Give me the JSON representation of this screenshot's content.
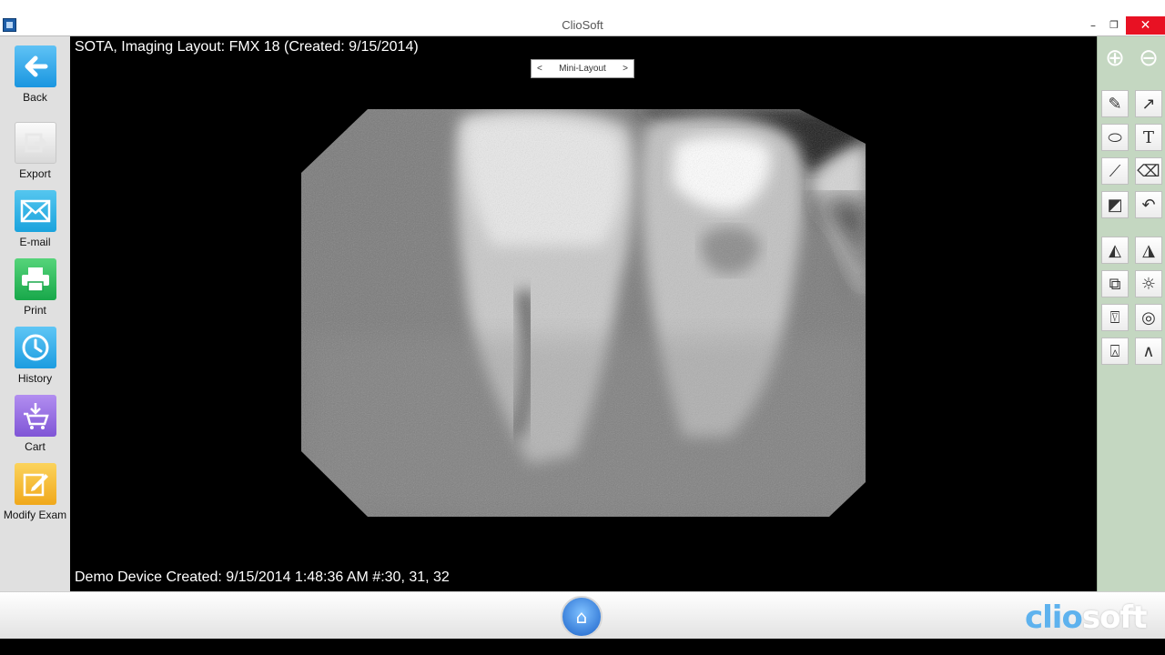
{
  "window": {
    "title": "ClioSoft",
    "min": "–",
    "max": "❐",
    "close": "✕"
  },
  "sidebar": {
    "items": [
      {
        "label": "Back",
        "glyph": "←"
      },
      {
        "label": "Export",
        "glyph": "⇱"
      },
      {
        "label": "E-mail",
        "glyph": "✉"
      },
      {
        "label": "Print",
        "glyph": "⎙"
      },
      {
        "label": "History",
        "glyph": "◷"
      },
      {
        "label": "Cart",
        "glyph": "⊻"
      },
      {
        "label": "Modify Exam",
        "glyph": "✎"
      }
    ]
  },
  "viewer": {
    "layout_title": "SOTA, Imaging  Layout: FMX 18 (Created: 9/15/2014)",
    "mini_layout": {
      "prev": "<",
      "label": "Mini-Layout",
      "next": ">"
    },
    "device_info": "Demo Device Created: 9/15/2014 1:48:36 AM #:30, 31, 32"
  },
  "toolbar": {
    "tools": [
      "zoom-in-icon",
      "zoom-out-icon",
      "pencil-icon",
      "arrow-line-icon",
      "ellipse-icon",
      "text-icon",
      "ruler-icon",
      "eraser-icon",
      "contrast-icon",
      "undo-icon",
      "flip-horizontal-icon",
      "flip-vertical-icon",
      "overlay-icon",
      "brightness-icon",
      "tooth-icon",
      "circle-target-icon",
      "tooth-crown-icon",
      "angle-icon"
    ],
    "glyphs": {
      "zoom_in": "⊕",
      "zoom_out": "⊖",
      "pencil": "✎",
      "arrow": "↗",
      "ellipse": "⬭",
      "text": "T",
      "ruler": "⟋",
      "eraser": "⌫",
      "contrast": "◩",
      "undo": "↶",
      "flip_h": "◭",
      "flip_v": "◮",
      "overlay": "⧉",
      "brightness": "☼",
      "tooth": "⍔",
      "target": "◎",
      "crown": "⍓",
      "angle": "∧"
    }
  },
  "bottom": {
    "brand_clio": "clio",
    "brand_soft": "soft",
    "home_glyph": "⌂"
  },
  "colors": {
    "toolbar_bg": "#c4d7c1",
    "sidebar_bg": "#e0e0e0",
    "brand_blue": "#5eb2ee",
    "close_red": "#e81123"
  }
}
